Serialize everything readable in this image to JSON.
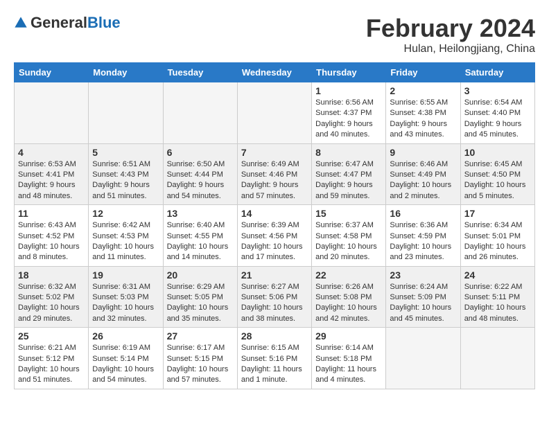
{
  "logo": {
    "text_general": "General",
    "text_blue": "Blue"
  },
  "header": {
    "month_title": "February 2024",
    "location": "Hulan, Heilongjiang, China"
  },
  "weekdays": [
    "Sunday",
    "Monday",
    "Tuesday",
    "Wednesday",
    "Thursday",
    "Friday",
    "Saturday"
  ],
  "weeks": [
    {
      "shaded": false,
      "days": [
        {
          "num": "",
          "info": "",
          "empty": true
        },
        {
          "num": "",
          "info": "",
          "empty": true
        },
        {
          "num": "",
          "info": "",
          "empty": true
        },
        {
          "num": "",
          "info": "",
          "empty": true
        },
        {
          "num": "1",
          "info": "Sunrise: 6:56 AM\nSunset: 4:37 PM\nDaylight: 9 hours\nand 40 minutes.",
          "empty": false
        },
        {
          "num": "2",
          "info": "Sunrise: 6:55 AM\nSunset: 4:38 PM\nDaylight: 9 hours\nand 43 minutes.",
          "empty": false
        },
        {
          "num": "3",
          "info": "Sunrise: 6:54 AM\nSunset: 4:40 PM\nDaylight: 9 hours\nand 45 minutes.",
          "empty": false
        }
      ]
    },
    {
      "shaded": true,
      "days": [
        {
          "num": "4",
          "info": "Sunrise: 6:53 AM\nSunset: 4:41 PM\nDaylight: 9 hours\nand 48 minutes.",
          "empty": false
        },
        {
          "num": "5",
          "info": "Sunrise: 6:51 AM\nSunset: 4:43 PM\nDaylight: 9 hours\nand 51 minutes.",
          "empty": false
        },
        {
          "num": "6",
          "info": "Sunrise: 6:50 AM\nSunset: 4:44 PM\nDaylight: 9 hours\nand 54 minutes.",
          "empty": false
        },
        {
          "num": "7",
          "info": "Sunrise: 6:49 AM\nSunset: 4:46 PM\nDaylight: 9 hours\nand 57 minutes.",
          "empty": false
        },
        {
          "num": "8",
          "info": "Sunrise: 6:47 AM\nSunset: 4:47 PM\nDaylight: 9 hours\nand 59 minutes.",
          "empty": false
        },
        {
          "num": "9",
          "info": "Sunrise: 6:46 AM\nSunset: 4:49 PM\nDaylight: 10 hours\nand 2 minutes.",
          "empty": false
        },
        {
          "num": "10",
          "info": "Sunrise: 6:45 AM\nSunset: 4:50 PM\nDaylight: 10 hours\nand 5 minutes.",
          "empty": false
        }
      ]
    },
    {
      "shaded": false,
      "days": [
        {
          "num": "11",
          "info": "Sunrise: 6:43 AM\nSunset: 4:52 PM\nDaylight: 10 hours\nand 8 minutes.",
          "empty": false
        },
        {
          "num": "12",
          "info": "Sunrise: 6:42 AM\nSunset: 4:53 PM\nDaylight: 10 hours\nand 11 minutes.",
          "empty": false
        },
        {
          "num": "13",
          "info": "Sunrise: 6:40 AM\nSunset: 4:55 PM\nDaylight: 10 hours\nand 14 minutes.",
          "empty": false
        },
        {
          "num": "14",
          "info": "Sunrise: 6:39 AM\nSunset: 4:56 PM\nDaylight: 10 hours\nand 17 minutes.",
          "empty": false
        },
        {
          "num": "15",
          "info": "Sunrise: 6:37 AM\nSunset: 4:58 PM\nDaylight: 10 hours\nand 20 minutes.",
          "empty": false
        },
        {
          "num": "16",
          "info": "Sunrise: 6:36 AM\nSunset: 4:59 PM\nDaylight: 10 hours\nand 23 minutes.",
          "empty": false
        },
        {
          "num": "17",
          "info": "Sunrise: 6:34 AM\nSunset: 5:01 PM\nDaylight: 10 hours\nand 26 minutes.",
          "empty": false
        }
      ]
    },
    {
      "shaded": true,
      "days": [
        {
          "num": "18",
          "info": "Sunrise: 6:32 AM\nSunset: 5:02 PM\nDaylight: 10 hours\nand 29 minutes.",
          "empty": false
        },
        {
          "num": "19",
          "info": "Sunrise: 6:31 AM\nSunset: 5:03 PM\nDaylight: 10 hours\nand 32 minutes.",
          "empty": false
        },
        {
          "num": "20",
          "info": "Sunrise: 6:29 AM\nSunset: 5:05 PM\nDaylight: 10 hours\nand 35 minutes.",
          "empty": false
        },
        {
          "num": "21",
          "info": "Sunrise: 6:27 AM\nSunset: 5:06 PM\nDaylight: 10 hours\nand 38 minutes.",
          "empty": false
        },
        {
          "num": "22",
          "info": "Sunrise: 6:26 AM\nSunset: 5:08 PM\nDaylight: 10 hours\nand 42 minutes.",
          "empty": false
        },
        {
          "num": "23",
          "info": "Sunrise: 6:24 AM\nSunset: 5:09 PM\nDaylight: 10 hours\nand 45 minutes.",
          "empty": false
        },
        {
          "num": "24",
          "info": "Sunrise: 6:22 AM\nSunset: 5:11 PM\nDaylight: 10 hours\nand 48 minutes.",
          "empty": false
        }
      ]
    },
    {
      "shaded": false,
      "days": [
        {
          "num": "25",
          "info": "Sunrise: 6:21 AM\nSunset: 5:12 PM\nDaylight: 10 hours\nand 51 minutes.",
          "empty": false
        },
        {
          "num": "26",
          "info": "Sunrise: 6:19 AM\nSunset: 5:14 PM\nDaylight: 10 hours\nand 54 minutes.",
          "empty": false
        },
        {
          "num": "27",
          "info": "Sunrise: 6:17 AM\nSunset: 5:15 PM\nDaylight: 10 hours\nand 57 minutes.",
          "empty": false
        },
        {
          "num": "28",
          "info": "Sunrise: 6:15 AM\nSunset: 5:16 PM\nDaylight: 11 hours\nand 1 minute.",
          "empty": false
        },
        {
          "num": "29",
          "info": "Sunrise: 6:14 AM\nSunset: 5:18 PM\nDaylight: 11 hours\nand 4 minutes.",
          "empty": false
        },
        {
          "num": "",
          "info": "",
          "empty": true
        },
        {
          "num": "",
          "info": "",
          "empty": true
        }
      ]
    }
  ]
}
